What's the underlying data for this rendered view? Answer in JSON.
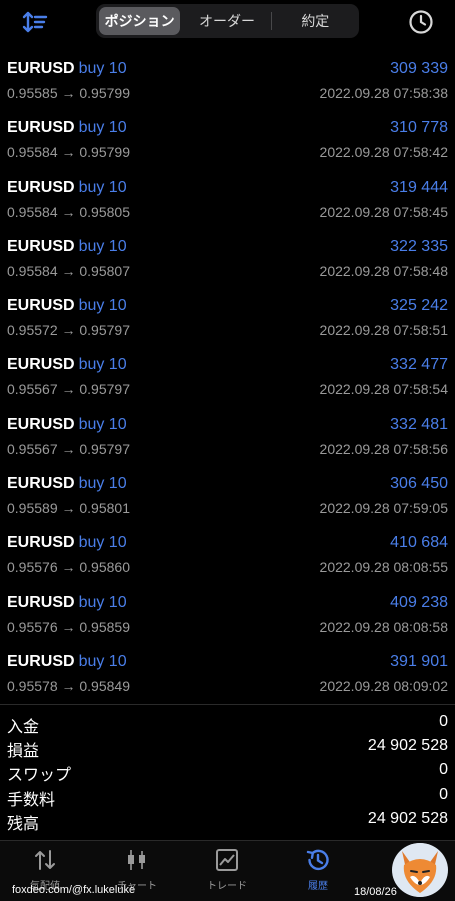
{
  "header": {
    "tabs": [
      {
        "label": "ポジション",
        "active": true
      },
      {
        "label": "オーダー",
        "active": false
      },
      {
        "label": "約定",
        "active": false
      }
    ],
    "left_icon": "sort-icon",
    "right_icon": "clock-icon"
  },
  "trades": [
    {
      "symbol": "EURUSD",
      "side": "buy 10",
      "prices": "0.95585 → 0.95799",
      "profit": "309 339",
      "time": "2022.09.28 07:58:38"
    },
    {
      "symbol": "EURUSD",
      "side": "buy 10",
      "prices": "0.95584 → 0.95799",
      "profit": "310 778",
      "time": "2022.09.28 07:58:42"
    },
    {
      "symbol": "EURUSD",
      "side": "buy 10",
      "prices": "0.95584 → 0.95805",
      "profit": "319 444",
      "time": "2022.09.28 07:58:45"
    },
    {
      "symbol": "EURUSD",
      "side": "buy 10",
      "prices": "0.95584 → 0.95807",
      "profit": "322 335",
      "time": "2022.09.28 07:58:48"
    },
    {
      "symbol": "EURUSD",
      "side": "buy 10",
      "prices": "0.95572 → 0.95797",
      "profit": "325 242",
      "time": "2022.09.28 07:58:51"
    },
    {
      "symbol": "EURUSD",
      "side": "buy 10",
      "prices": "0.95567 → 0.95797",
      "profit": "332 477",
      "time": "2022.09.28 07:58:54"
    },
    {
      "symbol": "EURUSD",
      "side": "buy 10",
      "prices": "0.95567 → 0.95797",
      "profit": "332 481",
      "time": "2022.09.28 07:58:56"
    },
    {
      "symbol": "EURUSD",
      "side": "buy 10",
      "prices": "0.95589 → 0.95801",
      "profit": "306 450",
      "time": "2022.09.28 07:59:05"
    },
    {
      "symbol": "EURUSD",
      "side": "buy 10",
      "prices": "0.95576 → 0.95860",
      "profit": "410 684",
      "time": "2022.09.28 08:08:55"
    },
    {
      "symbol": "EURUSD",
      "side": "buy 10",
      "prices": "0.95576 → 0.95859",
      "profit": "409 238",
      "time": "2022.09.28 08:08:58"
    },
    {
      "symbol": "EURUSD",
      "side": "buy 10",
      "prices": "0.95578 → 0.95849",
      "profit": "391 901",
      "time": "2022.09.28 08:09:02"
    }
  ],
  "summary": [
    {
      "label": "入金",
      "value": "0"
    },
    {
      "label": "損益",
      "value": "24 902 528"
    },
    {
      "label": "スワップ",
      "value": "0"
    },
    {
      "label": "手数料",
      "value": "0"
    },
    {
      "label": "残高",
      "value": "24 902 528"
    }
  ],
  "nav": [
    {
      "label": "気配値",
      "icon": "quotes-icon",
      "active": false
    },
    {
      "label": "チャート",
      "icon": "chart-icon",
      "active": false
    },
    {
      "label": "トレード",
      "icon": "trade-icon",
      "active": false
    },
    {
      "label": "履歴",
      "icon": "history-icon",
      "active": true
    }
  ],
  "watermark": {
    "left": "foxdeo.com/@fx.lukeluke",
    "right": "18/08/26"
  },
  "colors": {
    "accent": "#4a7ee8",
    "background": "#000000",
    "muted": "#9a9a9a",
    "segment_bg": "#1c1c1e",
    "segment_active": "#5a5a5e"
  }
}
